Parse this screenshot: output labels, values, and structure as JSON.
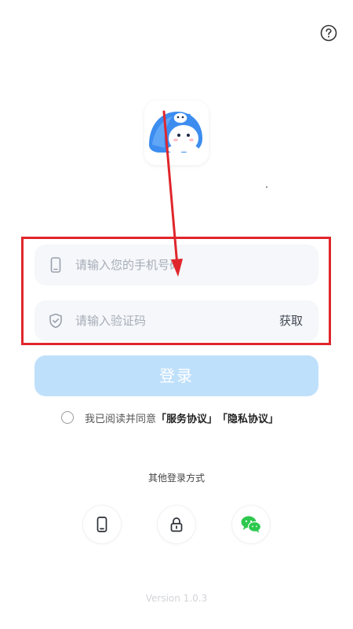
{
  "header": {
    "help_icon": "question-circle-icon"
  },
  "logo": {
    "icon": "mascot-logo"
  },
  "form": {
    "phone": {
      "icon": "phone-icon",
      "value": "",
      "placeholder": "请输入您的手机号码"
    },
    "code": {
      "icon": "shield-check-icon",
      "value": "",
      "placeholder": "请输入验证码",
      "get_code_label": "获取"
    },
    "login_label": "登录"
  },
  "agreement": {
    "checked": false,
    "prefix": "我已阅读并同意",
    "service_link": "「服务协议」",
    "privacy_link": "「隐私协议」"
  },
  "other_login": {
    "title": "其他登录方式",
    "methods": [
      {
        "icon": "phone-icon"
      },
      {
        "icon": "lock-icon"
      },
      {
        "icon": "wechat-icon"
      }
    ]
  },
  "footer": {
    "version": "Version 1.0.3"
  },
  "annotation": {
    "color": "#e0262c"
  },
  "colors": {
    "login_button_bg": "#bfe0fb",
    "field_bg": "#f5f7fa",
    "wechat_green": "#2dc84d"
  }
}
